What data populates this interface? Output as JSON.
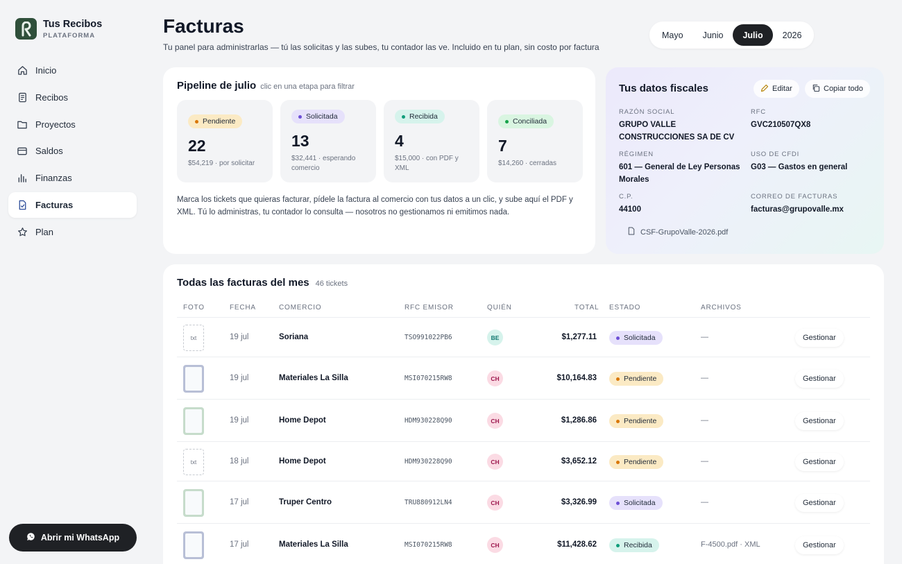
{
  "brand": {
    "title": "Tus Recibos",
    "subtitle": "PLATAFORMA"
  },
  "sidebar": {
    "items": [
      {
        "label": "Inicio",
        "icon": "home-icon",
        "active": false
      },
      {
        "label": "Recibos",
        "icon": "receipt-icon",
        "active": false
      },
      {
        "label": "Proyectos",
        "icon": "folder-icon",
        "active": false
      },
      {
        "label": "Saldos",
        "icon": "wallet-icon",
        "active": false
      },
      {
        "label": "Finanzas",
        "icon": "bar-chart-icon",
        "active": false
      },
      {
        "label": "Facturas",
        "icon": "invoice-icon",
        "active": true
      },
      {
        "label": "Plan",
        "icon": "star-icon",
        "active": false
      }
    ],
    "whatsapp_label": "Abrir mi WhatsApp"
  },
  "header": {
    "title": "Facturas",
    "subtitle": "Tu panel para administrarlas — tú las solicitas y las subes, tu contador las ve. Incluido en tu plan, sin costo por factura",
    "tabs": [
      {
        "label": "Mayo",
        "active": false
      },
      {
        "label": "Junio",
        "active": false
      },
      {
        "label": "Julio",
        "active": true
      },
      {
        "label": "2026",
        "active": false
      }
    ]
  },
  "pipeline": {
    "title": "Pipeline de julio",
    "hint": "clic en una etapa para filtrar",
    "stages": [
      {
        "label": "Pendiente",
        "count": "22",
        "meta": "$54,219 · por solicitar"
      },
      {
        "label": "Solicitada",
        "count": "13",
        "meta": "$32,441 · esperando comercio"
      },
      {
        "label": "Recibida",
        "count": "4",
        "meta": "$15,000 · con PDF y XML"
      },
      {
        "label": "Conciliada",
        "count": "7",
        "meta": "$14,260 · cerradas"
      }
    ],
    "description": "Marca los tickets que quieras facturar, pídele la factura al comercio con tus datos a un clic, y sube aquí el PDF y XML. Tú lo administras, tu contador lo consulta — nosotros no gestionamos ni emitimos nada."
  },
  "fiscal": {
    "title": "Tus datos fiscales",
    "edit_label": "Editar",
    "copy_label": "Copiar todo",
    "razon_social_label": "RAZÓN SOCIAL",
    "razon_social": "GRUPO VALLE CONSTRUCCIONES SA DE CV",
    "rfc_label": "RFC",
    "rfc": "GVC210507QX8",
    "regimen_label": "RÉGIMEN",
    "regimen": "601 — General de Ley Personas Morales",
    "uso_label": "USO DE CFDI",
    "uso": "G03 — Gastos en general",
    "cp_label": "C.P.",
    "cp": "44100",
    "correo_label": "CORREO DE FACTURAS",
    "correo": "facturas@grupovalle.mx",
    "file": "CSF-GrupoValle-2026.pdf"
  },
  "table": {
    "title": "Todas las facturas del mes",
    "count": "46 tickets",
    "columns": {
      "foto": "FOTO",
      "fecha": "FECHA",
      "comercio": "COMERCIO",
      "rfc": "RFC EMISOR",
      "quien": "QUIÉN",
      "total": "TOTAL",
      "estado": "ESTADO",
      "archivos": "ARCHIVOS"
    },
    "action_label": "Gestionar",
    "rows": [
      {
        "foto": "txt",
        "fecha": "19 jul",
        "comercio": "Soriana",
        "rfc": "TSO991022PB6",
        "quien": "BE",
        "total": "$1,277.11",
        "estado": "Solicitada",
        "archivos": "—"
      },
      {
        "foto": "img-blue",
        "fecha": "19 jul",
        "comercio": "Materiales La Silla",
        "rfc": "MSI070215RW8",
        "quien": "CH",
        "total": "$10,164.83",
        "estado": "Pendiente",
        "archivos": "—"
      },
      {
        "foto": "img-green",
        "fecha": "19 jul",
        "comercio": "Home Depot",
        "rfc": "HDM930228Q90",
        "quien": "CH",
        "total": "$1,286.86",
        "estado": "Pendiente",
        "archivos": "—"
      },
      {
        "foto": "txt",
        "fecha": "18 jul",
        "comercio": "Home Depot",
        "rfc": "HDM930228Q90",
        "quien": "CH",
        "total": "$3,652.12",
        "estado": "Pendiente",
        "archivos": "—"
      },
      {
        "foto": "img-green",
        "fecha": "17 jul",
        "comercio": "Truper Centro",
        "rfc": "TRU880912LN4",
        "quien": "CH",
        "total": "$3,326.99",
        "estado": "Solicitada",
        "archivos": "—"
      },
      {
        "foto": "img-blue",
        "fecha": "17 jul",
        "comercio": "Materiales La Silla",
        "rfc": "MSI070215RW8",
        "quien": "CH",
        "total": "$11,428.62",
        "estado": "Recibida",
        "archivos": "F-4500.pdf · XML"
      }
    ]
  },
  "colors": {
    "pendiente": "#fbeac4",
    "solicitada": "#e6e1fb",
    "recibida": "#d6f3ec",
    "conciliada": "#d9f5e1",
    "dark": "#1f2125",
    "brand": "#2f4f3a"
  }
}
